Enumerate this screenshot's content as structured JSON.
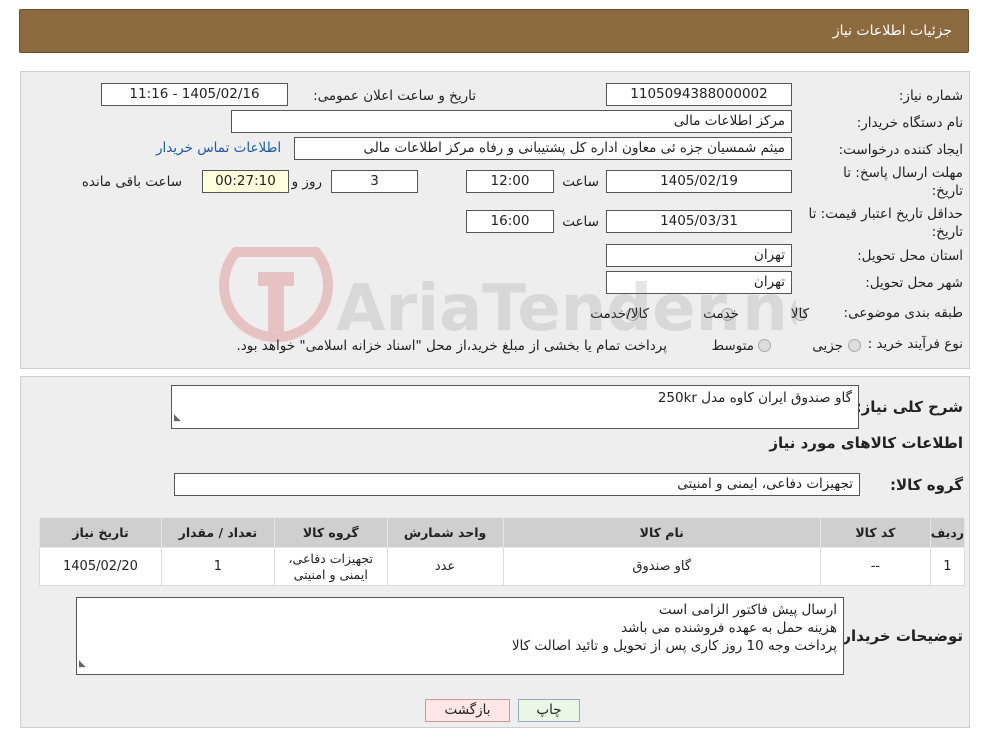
{
  "header": {
    "title": "جزئیات اطلاعات نیاز"
  },
  "watermark": {
    "text": "AriaTender.neT"
  },
  "form": {
    "need_number_label": "شماره نیاز:",
    "need_number": "1105094388000002",
    "announce_label": "تاریخ و ساعت اعلان عمومی:",
    "announce_value": "1405/02/16 - 11:16",
    "buyer_org_label": "نام دستگاه خریدار:",
    "buyer_org": "مرکز اطلاعات مالی",
    "requester_label": "ایجاد کننده درخواست:",
    "requester": "میثم شمسیان جزه ئی معاون اداره کل پشتیبانی و رفاه مرکز اطلاعات مالی",
    "contact_link": "اطلاعات تماس خریدار",
    "deadline_label_1": "مهلت ارسال پاسخ: تا",
    "deadline_label_2": "تاریخ:",
    "deadline_date": "1405/02/19",
    "time_label": "ساعت",
    "deadline_time": "12:00",
    "days_value": "3",
    "days_label": "روز و",
    "remaining_time": "00:27:10",
    "remaining_label": "ساعت باقی مانده",
    "validity_label_1": "حداقل تاریخ اعتبار قیمت: تا",
    "validity_label_2": "تاریخ:",
    "validity_date": "1405/03/31",
    "validity_time": "16:00",
    "province_label": "استان محل تحویل:",
    "province": "تهران",
    "city_label": "شهر محل تحویل:",
    "city": "تهران",
    "category_label": "طبقه بندی موضوعی:",
    "category_options": [
      "کالا",
      "خدمت",
      "کالا/خدمت"
    ],
    "process_label": "نوع فرآیند خرید :",
    "process_options": [
      "جزیی",
      "متوسط"
    ],
    "payment_note": "پرداخت تمام یا بخشی از مبلغ خرید،از محل \"اسناد خزانه اسلامی\" خواهد بود."
  },
  "details": {
    "summary_label": "شرح کلی نیاز:",
    "summary": "گاو صندوق ایران کاوه مدل 250kr",
    "goods_title": "اطلاعات کالاهای مورد نیاز",
    "group_label": "گروه کالا:",
    "group_value": "تجهیزات دفاعی، ایمنی و امنیتی",
    "table": {
      "headers": [
        "ردیف",
        "کد کالا",
        "نام کالا",
        "واحد شمارش",
        "گروه کالا",
        "تعداد / مقدار",
        "تاریخ نیاز"
      ],
      "rows": [
        [
          "1",
          "--",
          "گاو صندوق",
          "عدد",
          "تجهیزات دفاعی، ایمنی و امنیتی",
          "1",
          "1405/02/20"
        ]
      ]
    },
    "buyer_notes_label": "توضیحات خریدار:",
    "buyer_notes": [
      "ارسال پیش فاکتور الزامی است",
      "هزینه حمل به عهده فروشنده می باشد",
      "پرداخت وجه 10 روز کاری پس از تحویل و تائید اصالت کالا"
    ]
  },
  "buttons": {
    "print": "چاپ",
    "back": "بازگشت"
  },
  "colors": {
    "header": "#8c6a3f",
    "link": "#1d5aa6",
    "back_button": "#ffe6e6",
    "print_button": "#eaf7e4"
  }
}
